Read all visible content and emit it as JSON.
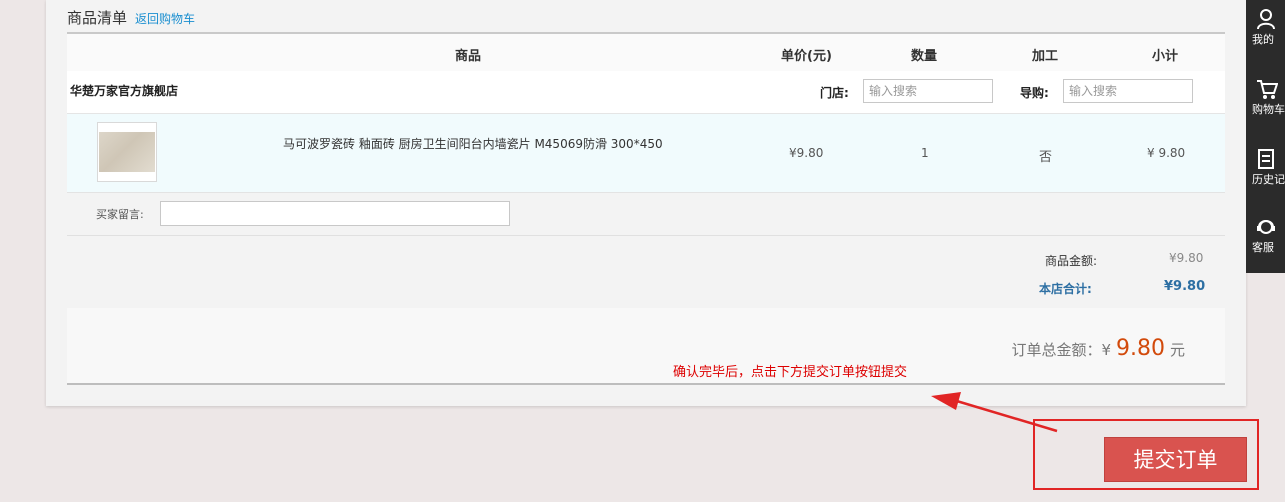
{
  "header": {
    "title": "商品清单",
    "back_link": "返回购物车"
  },
  "columns": {
    "product": "商品",
    "unit_price": "单价(元)",
    "quantity": "数量",
    "processing": "加工",
    "subtotal": "小计"
  },
  "store": {
    "name": "华楚万家官方旗舰店",
    "store_label": "门店:",
    "store_placeholder": "输入搜索",
    "guide_label": "导购:",
    "guide_placeholder": "输入搜索"
  },
  "product": {
    "name": "马可波罗瓷砖 釉面砖 厨房卫生间阳台内墙瓷片 M45069防滑 300*450",
    "unit_price": "¥9.80",
    "quantity": "1",
    "processing": "否",
    "subtotal": "¥ 9.80"
  },
  "message": {
    "label": "买家留言:"
  },
  "summary": {
    "goods_label": "商品金额:",
    "goods_value": "¥9.80",
    "store_total_label": "本店合计:",
    "store_total_value": "¥9.80"
  },
  "order_total": {
    "label": "订单总金额：¥",
    "amount": "9.80",
    "unit": "元"
  },
  "hint": "确认完毕后，点击下方提交订单按钮提交",
  "submit_label": "提交订单",
  "sidebar": {
    "items": [
      "我的",
      "购物车",
      "历史记",
      "客服"
    ]
  },
  "colors": {
    "accent_red": "#d9534f",
    "price_orange": "#d24a0b",
    "link_blue": "#1b8fd0",
    "annotation_red": "#e12525"
  }
}
